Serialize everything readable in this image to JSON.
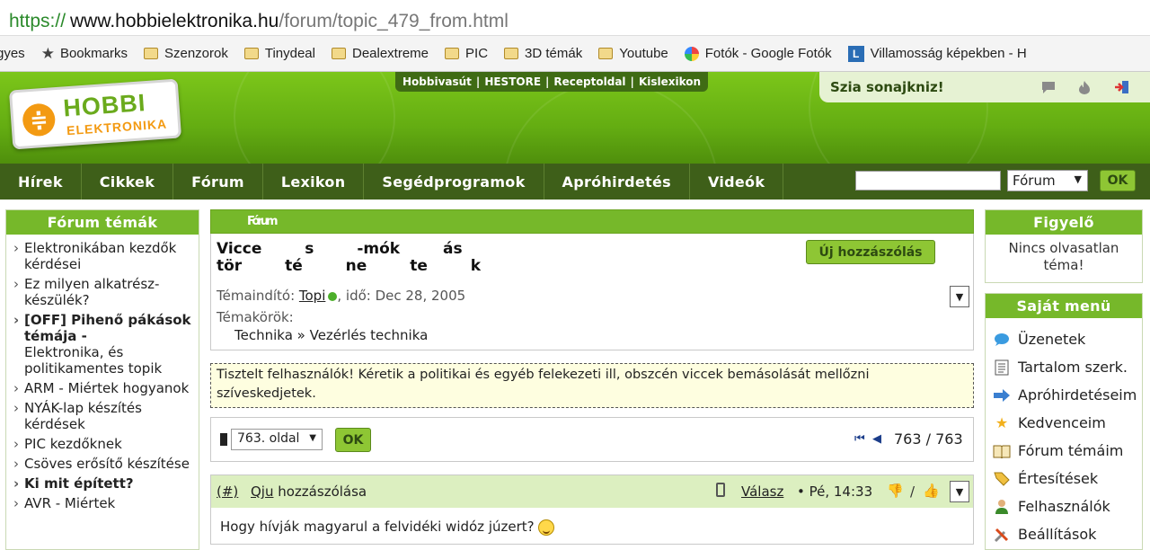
{
  "browser": {
    "url_scheme": "https://",
    "url_domain": "www.hobbielektronika.hu",
    "url_path": "/forum/topic_479_from.html",
    "bookmarks": [
      {
        "label": "gyes",
        "icon": "none"
      },
      {
        "label": "Bookmarks",
        "icon": "star-icon"
      },
      {
        "label": "Szenzorok",
        "icon": "folder-icon"
      },
      {
        "label": "Tinydeal",
        "icon": "folder-icon"
      },
      {
        "label": "Dealextreme",
        "icon": "folder-icon"
      },
      {
        "label": "PIC",
        "icon": "folder-icon"
      },
      {
        "label": "3D témák",
        "icon": "folder-icon"
      },
      {
        "label": "Youtube",
        "icon": "folder-icon"
      },
      {
        "label": "Fotók - Google Fotók",
        "icon": "google-photos-icon"
      },
      {
        "label": "Villamosság képekben - H",
        "icon": "l-icon"
      }
    ]
  },
  "header": {
    "logo_top": "HOBBI",
    "logo_bottom": "ELEKTRONIKA",
    "logo_symbol": "≑",
    "toplinks": [
      "Hobbivasút",
      "HESTORE",
      "Receptoldal",
      "Kislexikon"
    ],
    "greeting": "Szia sonajkniz!"
  },
  "nav": {
    "items": [
      "Hírek",
      "Cikkek",
      "Fórum",
      "Lexikon",
      "Segédprogramok",
      "Apróhirdetés",
      "Videók"
    ],
    "search_select": "Fórum",
    "ok": "OK"
  },
  "left": {
    "title": "Fórum témák",
    "items": [
      {
        "label": "Elektronikában kezdők kérdései",
        "bold": false
      },
      {
        "label": "Ez milyen alkatrész-készülék?",
        "bold": false
      },
      {
        "label": "[OFF] Pihenő pákások témája -",
        "sub": "Elektronika, és politikamentes topik",
        "bold": true
      },
      {
        "label": "ARM - Miértek hogyanok",
        "bold": false
      },
      {
        "label": "NYÁK-lap készítés kérdések",
        "bold": false
      },
      {
        "label": "PIC kezdőknek",
        "bold": false
      },
      {
        "label": "Csöves erősítő készítése",
        "bold": false
      },
      {
        "label": "Ki mit épített?",
        "bold": true
      },
      {
        "label": "AVR - Miértek",
        "bold": false
      }
    ]
  },
  "topic": {
    "crumb": "Fórum",
    "title": "Vicce s -mók ás tör té ne te k",
    "new_post": "Új hozzászólás",
    "starter_label": "Témaindító: ",
    "starter": "Topi",
    "date_text": ", idő: Dec 28, 2005",
    "cats_label": "Témakörök:",
    "cats": "Technika » Vezérlés technika"
  },
  "notice": "Tisztelt felhasználók! Kéretik a politikai és egyéb felekezeti ill, obszcén viccek bemásolását mellőzni szíveskedjetek.",
  "pager": {
    "page_select": "763. oldal",
    "ok": "OK",
    "first_icon": "⏮",
    "prev_icon": "◀",
    "count": "763 / 763"
  },
  "post": {
    "num": "(#)",
    "author": "Qju",
    "author_suffix": " hozzászólása",
    "reply": "Válasz",
    "time": "• Pé, 14:33",
    "body": "Hogy hívják magyarul a felvidéki widóz júzert?"
  },
  "right": {
    "watch_title": "Figyelő",
    "watch_text": "Nincs olvasatlan téma!",
    "menu_title": "Saját menü",
    "menu": [
      {
        "label": "Üzenetek",
        "icon": "speech-bubble-icon"
      },
      {
        "label": "Tartalom szerk.",
        "icon": "document-icon"
      },
      {
        "label": "Apróhirdetéseim",
        "icon": "arrow-right-icon"
      },
      {
        "label": "Kedvenceim",
        "icon": "star-icon"
      },
      {
        "label": "Fórum témáim",
        "icon": "book-icon"
      },
      {
        "label": "Értesítések",
        "icon": "tag-icon"
      },
      {
        "label": "Felhasználók",
        "icon": "user-icon"
      },
      {
        "label": "Beállítások",
        "icon": "tools-icon"
      }
    ]
  }
}
